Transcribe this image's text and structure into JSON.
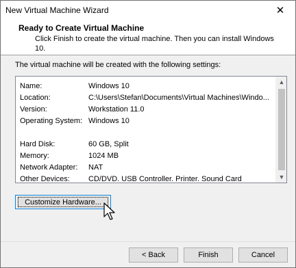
{
  "window": {
    "title": "New Virtual Machine Wizard",
    "close_glyph": "✕"
  },
  "header": {
    "title": "Ready to Create Virtual Machine",
    "description": "Click Finish to create the virtual machine. Then you can install Windows 10."
  },
  "intro": "The virtual machine will be created with the following settings:",
  "settings": [
    {
      "key": "Name:",
      "value": "Windows 10"
    },
    {
      "key": "Location:",
      "value": "C:\\Users\\Stefan\\Documents\\Virtual Machines\\Windo..."
    },
    {
      "key": "Version:",
      "value": "Workstation 11.0"
    },
    {
      "key": "Operating System:",
      "value": "Windows 10"
    },
    {
      "key": "Hard Disk:",
      "value": "60 GB, Split"
    },
    {
      "key": "Memory:",
      "value": "1024 MB"
    },
    {
      "key": "Network Adapter:",
      "value": "NAT"
    },
    {
      "key": "Other Devices:",
      "value": "CD/DVD, USB Controller, Printer, Sound Card"
    }
  ],
  "scrollbar": {
    "up": "▲",
    "down": "▼"
  },
  "customize_button": "Customize Hardware...",
  "buttons": {
    "back": "< Back",
    "finish": "Finish",
    "cancel": "Cancel"
  },
  "icons": {
    "close": "close-icon",
    "cursor": "mouse-pointer-icon"
  },
  "colors": {
    "focus_border": "#0078d7",
    "button_face": "#e1e1e1",
    "window_bg": "#f0f0f0"
  }
}
